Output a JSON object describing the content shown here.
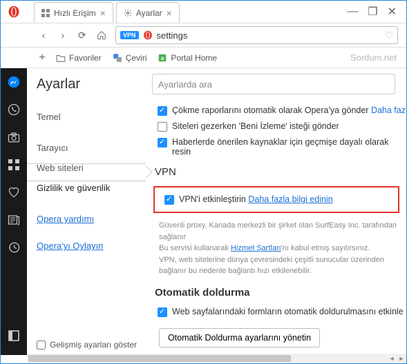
{
  "window": {
    "tabs": [
      {
        "label": "Hızlı Erişim",
        "icon": "speed-dial"
      },
      {
        "label": "Ayarlar",
        "icon": "gear"
      }
    ],
    "minimize": "—",
    "restore": "❐",
    "close": "✕"
  },
  "nav": {
    "back": "‹",
    "forward": "›",
    "reload": "⟳",
    "home": "⌂",
    "vpn_badge": "VPN",
    "address": "settings",
    "heart": "♡"
  },
  "bookmarks": {
    "add": "+",
    "items": [
      {
        "label": "Favoriler",
        "icon": "folder"
      },
      {
        "label": "Çeviri",
        "icon": "translate"
      },
      {
        "label": "Portal Home",
        "icon": "portal"
      }
    ],
    "watermark": "Sordum.net"
  },
  "sidebar_icons": [
    "messenger",
    "whatsapp",
    "camera",
    "grid",
    "heart",
    "news",
    "history",
    "panel"
  ],
  "settings": {
    "title": "Ayarlar",
    "search_placeholder": "Ayarlarda ara",
    "nav_items": [
      "Temel",
      "Tarayıcı",
      "Web siteleri",
      "Gizlilik ve güvenlik"
    ],
    "selected_index": 3,
    "help_link": "Opera yardımı",
    "rate_link": "Opera'yı Oylayın",
    "advanced_label": "Gelişmiş ayarları göster",
    "advanced_checked": false,
    "privacy": {
      "crash_label": "Çökme raporlarını otomatik olarak Opera'ya gönder",
      "crash_more": "Daha faz",
      "dnt_label": "Siteleri gezerken 'Beni İzleme' isteği gönder",
      "news_label": "Haberlerde önerilen kaynaklar için geçmişe dayalı olarak resin"
    },
    "vpn": {
      "heading": "VPN",
      "enable_label": "VPN'i etkinleştirin",
      "learn_more": "Daha fazla bilgi edinin",
      "desc1": "Güvenli proxy, Kanada merkezli bir şirket olan SurfEasy Inc. tarafından sağlanır",
      "desc2a": "Bu servisi kullanarak ",
      "desc2_link": "Hizmet Şartları",
      "desc2b": "'nı kabul etmiş sayılırsınız.",
      "desc3": "VPN, web sitelerine dünya çevresindeki çeşitli sunucular üzerinden bağlanır bu nedenle bağlantı hızı etkilenebilir."
    },
    "autofill": {
      "heading": "Otomatik doldurma",
      "forms_label": "Web sayfalarındaki formların otomatik doldurulmasını etkinle",
      "manage_button": "Otomatik Doldurma ayarlarını yönetin"
    }
  }
}
